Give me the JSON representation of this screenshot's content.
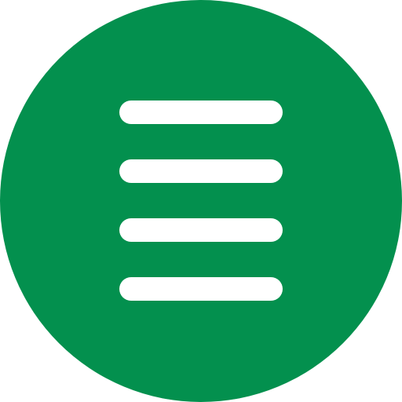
{
  "menu_icon": {
    "icon": "hamburger-menu-icon",
    "bars": [
      "bar",
      "bar",
      "bar",
      "bar"
    ],
    "colors": {
      "circle": "#03904E",
      "bars": "#FFFFFF",
      "background": "#FFFFFF"
    }
  }
}
